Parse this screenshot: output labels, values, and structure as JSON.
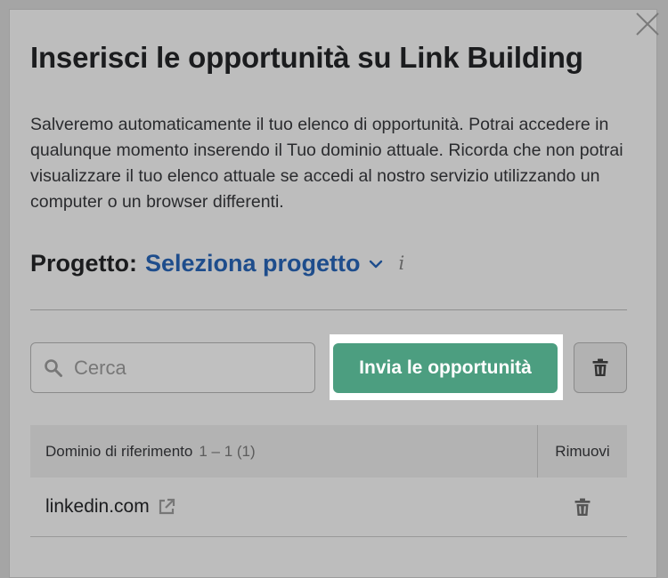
{
  "dialog": {
    "title": "Inserisci le opportunità su Link Building",
    "description": "Salveremo automaticamente il tuo elenco di opportunità. Potrai accedere in qualunque momento inserendo il Tuo dominio attuale. Ricorda che non potrai visualizzare il tuo elenco attuale se accedi al nostro servizio utilizzando un computer o un browser differenti.",
    "close_icon": "close-icon"
  },
  "project": {
    "label": "Progetto:",
    "select_label": "Seleziona progetto",
    "info": "i"
  },
  "search": {
    "placeholder": "Cerca",
    "value": ""
  },
  "actions": {
    "submit_label": "Invia le opportunità",
    "delete_icon": "trash-icon"
  },
  "table": {
    "columns": {
      "domain": "Dominio di riferimento",
      "count": "1 – 1 (1)",
      "remove": "Rimuovi"
    },
    "rows": [
      {
        "domain": "linkedin.com"
      }
    ]
  },
  "colors": {
    "accent": "#4c9e80",
    "link": "#1e4d8c",
    "highlight": "#ffffff"
  }
}
